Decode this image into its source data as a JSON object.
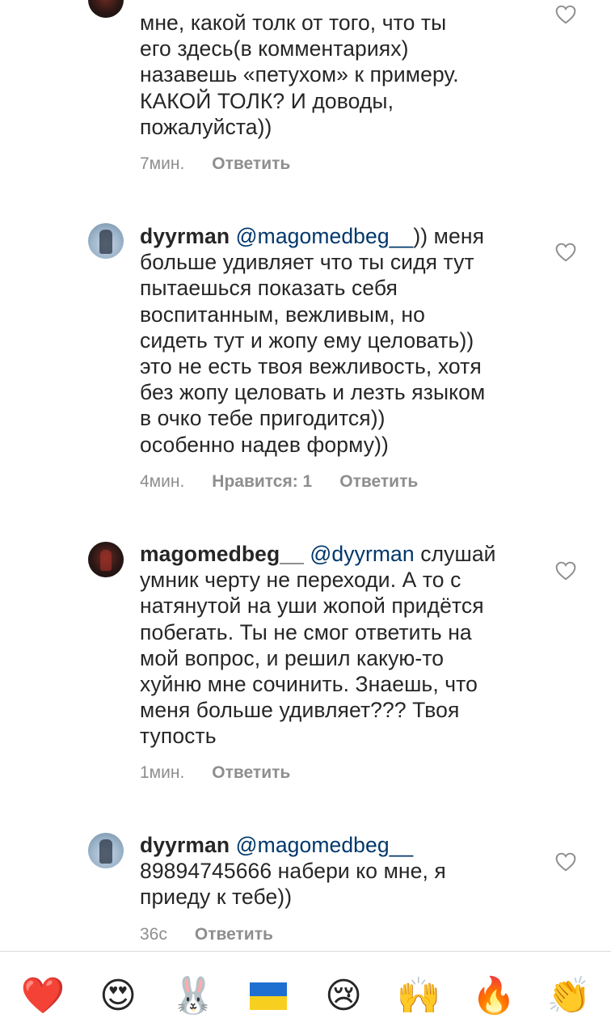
{
  "comments": [
    {
      "username": "",
      "mention": "",
      "text_lines": [
        "мне, какой толк от того, что ты",
        "его здесь(в комментариях)",
        "назавешь «петухом» к примеру.",
        "КАКОЙ ТОЛК? И доводы,",
        "пожалуйста))"
      ],
      "time": "7мин.",
      "likes": "",
      "reply": "Ответить"
    },
    {
      "username": "dyyrman",
      "mention": "@magomedbeg__",
      "first_line_rest": ")) меня",
      "text_lines": [
        "больше удивляет что ты сидя тут",
        "пытаешься показать себя",
        "воспитанным, вежливым, но",
        "сидеть тут и жопу ему целовать))",
        "это не есть твоя вежливость, хотя",
        "без жопу целовать и лезть языком",
        "в очко тебе пригодится))",
        "особенно надев форму))"
      ],
      "time": "4мин.",
      "likes": "Нравится: 1",
      "reply": "Ответить"
    },
    {
      "username": "magomedbeg__",
      "mention": "@dyyrman",
      "first_line_rest": "слушай",
      "text_lines": [
        "умник черту не переходи. А то с",
        "натянутой на уши жопой придётся",
        "побегать. Ты не смог ответить на",
        "мой вопрос, и решил какую-то",
        "хуйню мне сочинить. Знаешь, что",
        "меня больше удивляет??? Твоя",
        "тупость"
      ],
      "time": "1мин.",
      "likes": "",
      "reply": "Ответить"
    },
    {
      "username": "dyyrman",
      "mention": "@magomedbeg__",
      "first_line_rest": "",
      "text_lines": [
        "89894745666 набери ко мне, я",
        "приеду к тебе))"
      ],
      "time": "36с",
      "likes": "",
      "reply": "Ответить"
    }
  ],
  "icons": {
    "like": "heart-outline-icon",
    "color_like": "#8e8e8e"
  },
  "emoji_bar": [
    {
      "name": "red-heart-emoji",
      "glyph": "❤️"
    },
    {
      "name": "heart-eyes-emoji",
      "glyph": "😍"
    },
    {
      "name": "rabbit-emoji",
      "glyph": "🐰"
    },
    {
      "name": "ukraine-flag-emoji",
      "glyph": "🇺🇦"
    },
    {
      "name": "crying-face-emoji",
      "glyph": "😢"
    },
    {
      "name": "raising-hands-emoji",
      "glyph": "🙌"
    },
    {
      "name": "fire-emoji",
      "glyph": "🔥"
    },
    {
      "name": "clapping-hands-emoji",
      "glyph": "👏"
    }
  ]
}
